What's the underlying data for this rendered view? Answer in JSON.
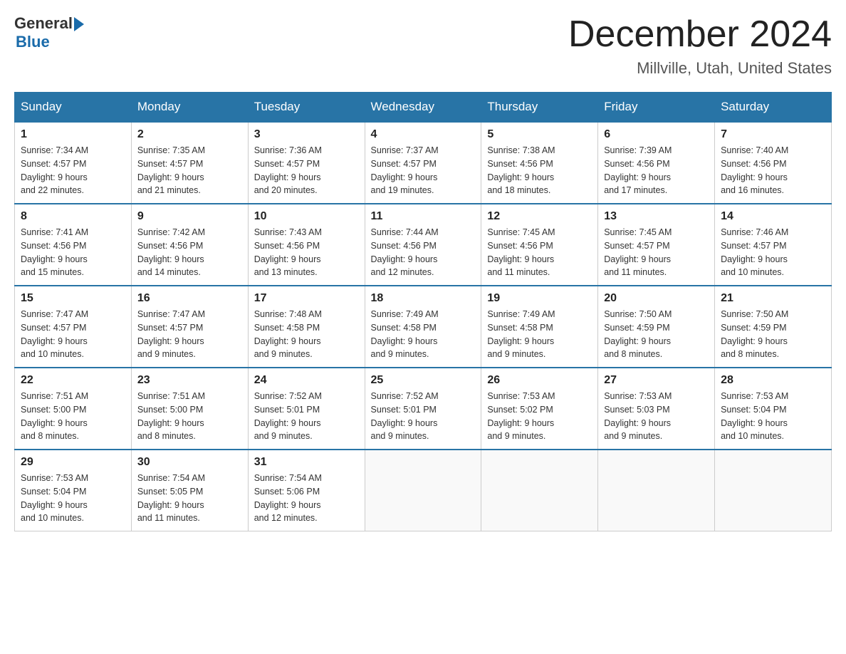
{
  "logo": {
    "general": "General",
    "blue": "Blue"
  },
  "title": "December 2024",
  "location": "Millville, Utah, United States",
  "days_of_week": [
    "Sunday",
    "Monday",
    "Tuesday",
    "Wednesday",
    "Thursday",
    "Friday",
    "Saturday"
  ],
  "weeks": [
    [
      {
        "num": "1",
        "sunrise": "7:34 AM",
        "sunset": "4:57 PM",
        "daylight": "9 hours and 22 minutes."
      },
      {
        "num": "2",
        "sunrise": "7:35 AM",
        "sunset": "4:57 PM",
        "daylight": "9 hours and 21 minutes."
      },
      {
        "num": "3",
        "sunrise": "7:36 AM",
        "sunset": "4:57 PM",
        "daylight": "9 hours and 20 minutes."
      },
      {
        "num": "4",
        "sunrise": "7:37 AM",
        "sunset": "4:57 PM",
        "daylight": "9 hours and 19 minutes."
      },
      {
        "num": "5",
        "sunrise": "7:38 AM",
        "sunset": "4:56 PM",
        "daylight": "9 hours and 18 minutes."
      },
      {
        "num": "6",
        "sunrise": "7:39 AM",
        "sunset": "4:56 PM",
        "daylight": "9 hours and 17 minutes."
      },
      {
        "num": "7",
        "sunrise": "7:40 AM",
        "sunset": "4:56 PM",
        "daylight": "9 hours and 16 minutes."
      }
    ],
    [
      {
        "num": "8",
        "sunrise": "7:41 AM",
        "sunset": "4:56 PM",
        "daylight": "9 hours and 15 minutes."
      },
      {
        "num": "9",
        "sunrise": "7:42 AM",
        "sunset": "4:56 PM",
        "daylight": "9 hours and 14 minutes."
      },
      {
        "num": "10",
        "sunrise": "7:43 AM",
        "sunset": "4:56 PM",
        "daylight": "9 hours and 13 minutes."
      },
      {
        "num": "11",
        "sunrise": "7:44 AM",
        "sunset": "4:56 PM",
        "daylight": "9 hours and 12 minutes."
      },
      {
        "num": "12",
        "sunrise": "7:45 AM",
        "sunset": "4:56 PM",
        "daylight": "9 hours and 11 minutes."
      },
      {
        "num": "13",
        "sunrise": "7:45 AM",
        "sunset": "4:57 PM",
        "daylight": "9 hours and 11 minutes."
      },
      {
        "num": "14",
        "sunrise": "7:46 AM",
        "sunset": "4:57 PM",
        "daylight": "9 hours and 10 minutes."
      }
    ],
    [
      {
        "num": "15",
        "sunrise": "7:47 AM",
        "sunset": "4:57 PM",
        "daylight": "9 hours and 10 minutes."
      },
      {
        "num": "16",
        "sunrise": "7:47 AM",
        "sunset": "4:57 PM",
        "daylight": "9 hours and 9 minutes."
      },
      {
        "num": "17",
        "sunrise": "7:48 AM",
        "sunset": "4:58 PM",
        "daylight": "9 hours and 9 minutes."
      },
      {
        "num": "18",
        "sunrise": "7:49 AM",
        "sunset": "4:58 PM",
        "daylight": "9 hours and 9 minutes."
      },
      {
        "num": "19",
        "sunrise": "7:49 AM",
        "sunset": "4:58 PM",
        "daylight": "9 hours and 9 minutes."
      },
      {
        "num": "20",
        "sunrise": "7:50 AM",
        "sunset": "4:59 PM",
        "daylight": "9 hours and 8 minutes."
      },
      {
        "num": "21",
        "sunrise": "7:50 AM",
        "sunset": "4:59 PM",
        "daylight": "9 hours and 8 minutes."
      }
    ],
    [
      {
        "num": "22",
        "sunrise": "7:51 AM",
        "sunset": "5:00 PM",
        "daylight": "9 hours and 8 minutes."
      },
      {
        "num": "23",
        "sunrise": "7:51 AM",
        "sunset": "5:00 PM",
        "daylight": "9 hours and 8 minutes."
      },
      {
        "num": "24",
        "sunrise": "7:52 AM",
        "sunset": "5:01 PM",
        "daylight": "9 hours and 9 minutes."
      },
      {
        "num": "25",
        "sunrise": "7:52 AM",
        "sunset": "5:01 PM",
        "daylight": "9 hours and 9 minutes."
      },
      {
        "num": "26",
        "sunrise": "7:53 AM",
        "sunset": "5:02 PM",
        "daylight": "9 hours and 9 minutes."
      },
      {
        "num": "27",
        "sunrise": "7:53 AM",
        "sunset": "5:03 PM",
        "daylight": "9 hours and 9 minutes."
      },
      {
        "num": "28",
        "sunrise": "7:53 AM",
        "sunset": "5:04 PM",
        "daylight": "9 hours and 10 minutes."
      }
    ],
    [
      {
        "num": "29",
        "sunrise": "7:53 AM",
        "sunset": "5:04 PM",
        "daylight": "9 hours and 10 minutes."
      },
      {
        "num": "30",
        "sunrise": "7:54 AM",
        "sunset": "5:05 PM",
        "daylight": "9 hours and 11 minutes."
      },
      {
        "num": "31",
        "sunrise": "7:54 AM",
        "sunset": "5:06 PM",
        "daylight": "9 hours and 12 minutes."
      },
      null,
      null,
      null,
      null
    ]
  ],
  "labels": {
    "sunrise": "Sunrise:",
    "sunset": "Sunset:",
    "daylight": "Daylight:"
  }
}
